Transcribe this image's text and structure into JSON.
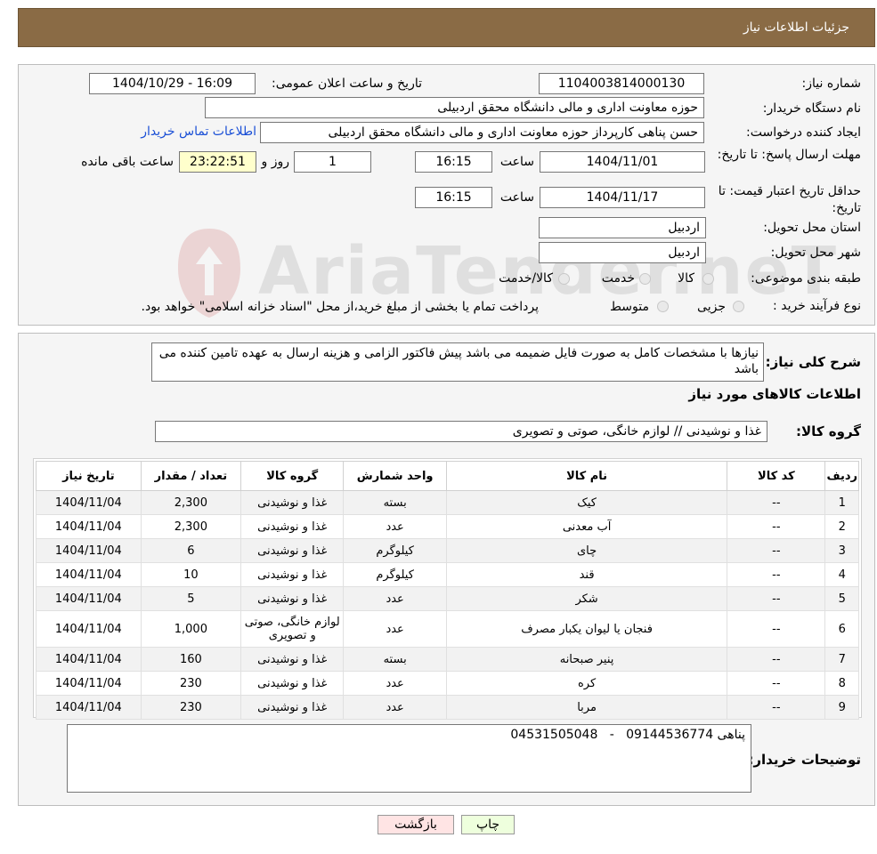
{
  "header": {
    "title": "جزئیات اطلاعات نیاز"
  },
  "fields": {
    "need_number_label": "شماره نیاز:",
    "need_number": "1104003814000130",
    "announce_label": "تاریخ و ساعت اعلان عمومی:",
    "announce_value": "1404/10/29 - 16:09",
    "buyer_label": "نام دستگاه خریدار:",
    "buyer_value": "حوزه معاونت اداری و مالی دانشگاه محقق اردبیلی",
    "creator_label": "ایجاد کننده درخواست:",
    "creator_value": "حسن پناهی کارپرداز حوزه معاونت اداری و مالی دانشگاه محقق اردبیلی",
    "contact_link": "اطلاعات تماس خریدار",
    "deadline_label": "مهلت ارسال پاسخ: تا تاریخ:",
    "deadline_date": "1404/11/01",
    "time_label": "ساعت",
    "deadline_time": "16:15",
    "days_value": "1",
    "days_label": "روز و",
    "remaining_value": "23:22:51",
    "remaining_label": "ساعت باقی مانده",
    "validity_label": "حداقل تاریخ اعتبار قیمت: تا تاریخ:",
    "validity_date": "1404/11/17",
    "validity_time": "16:15",
    "province_label": "استان محل تحویل:",
    "province_value": "اردبیل",
    "city_label": "شهر محل تحویل:",
    "city_value": "اردبیل",
    "category_label": "طبقه بندی موضوعی:",
    "category_options": [
      "کالا",
      "خدمت",
      "کالا/خدمت"
    ],
    "process_label": "نوع فرآیند خرید :",
    "process_options": [
      "جزیی",
      "متوسط"
    ],
    "process_note": "پرداخت تمام یا بخشی از مبلغ خرید،از محل \"اسناد خزانه اسلامی\" خواهد بود."
  },
  "description": {
    "label": "شرح کلی نیاز:",
    "text": "نیازها با مشخصات کامل به صورت فایل ضمیمه می باشد پیش فاکتور الزامی و هزینه ارسال به عهده تامین کننده می باشد"
  },
  "goods": {
    "section_title": "اطلاعات کالاهای مورد نیاز",
    "group_label": "گروه کالا:",
    "group_value": "غذا و نوشیدنی // لوازم خانگی، صوتی و تصویری"
  },
  "table": {
    "headers": [
      "ردیف",
      "کد کالا",
      "نام کالا",
      "واحد شمارش",
      "گروه کالا",
      "تعداد / مقدار",
      "تاریخ نیاز"
    ],
    "rows": [
      [
        "1",
        "--",
        "کیک",
        "بسته",
        "غذا و نوشیدنی",
        "2,300",
        "1404/11/04"
      ],
      [
        "2",
        "--",
        "آب معدنی",
        "عدد",
        "غذا و نوشیدنی",
        "2,300",
        "1404/11/04"
      ],
      [
        "3",
        "--",
        "چای",
        "کیلوگرم",
        "غذا و نوشیدنی",
        "6",
        "1404/11/04"
      ],
      [
        "4",
        "--",
        "قند",
        "کیلوگرم",
        "غذا و نوشیدنی",
        "10",
        "1404/11/04"
      ],
      [
        "5",
        "--",
        "شکر",
        "عدد",
        "غذا و نوشیدنی",
        "5",
        "1404/11/04"
      ],
      [
        "6",
        "--",
        "فنجان یا لیوان یکبار مصرف",
        "عدد",
        "لوازم خانگی، صوتی و تصویری",
        "1,000",
        "1404/11/04"
      ],
      [
        "7",
        "--",
        "پنیر صبحانه",
        "بسته",
        "غذا و نوشیدنی",
        "160",
        "1404/11/04"
      ],
      [
        "8",
        "--",
        "کره",
        "عدد",
        "غذا و نوشیدنی",
        "230",
        "1404/11/04"
      ],
      [
        "9",
        "--",
        "مربا",
        "عدد",
        "غذا و نوشیدنی",
        "230",
        "1404/11/04"
      ]
    ]
  },
  "buyer_notes": {
    "label": "توضیحات خریدار:",
    "text": "پناهی 09144536774   -   04531505048"
  },
  "buttons": {
    "print": "چاپ",
    "back": "بازگشت"
  },
  "watermark": {
    "text": "AriaTender.neT"
  }
}
